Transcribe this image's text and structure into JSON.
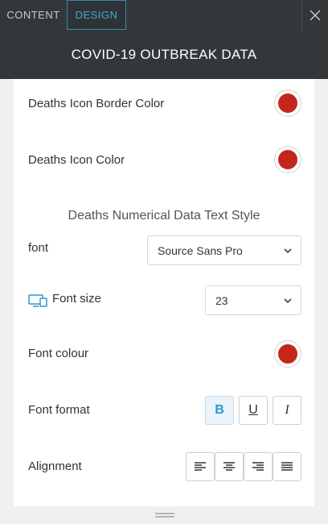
{
  "tabs": [
    {
      "label": "CONTENT",
      "active": false
    },
    {
      "label": "DESIGN",
      "active": true
    }
  ],
  "header": {
    "title": "COVID-19 OUTBREAK DATA"
  },
  "settings": {
    "icon_border_color": {
      "label": "Deaths Icon Border Color",
      "color": "#c4261d"
    },
    "icon_color": {
      "label": "Deaths Icon Color",
      "color": "#c4261d"
    },
    "section_title": "Deaths Numerical Data Text Style",
    "font": {
      "label": "font",
      "value": "Source Sans Pro"
    },
    "font_size": {
      "label": "Font size",
      "value": "23",
      "icon": "desktop-tablet-icon"
    },
    "font_colour": {
      "label": "Font colour",
      "color": "#c4261d"
    },
    "font_format": {
      "label": "Font format",
      "buttons": [
        {
          "glyph": "B",
          "name": "bold",
          "active": true
        },
        {
          "glyph": "U",
          "name": "underline",
          "active": false
        },
        {
          "glyph": "I",
          "name": "italic",
          "active": false
        }
      ]
    },
    "alignment": {
      "label": "Alignment",
      "options": [
        "left",
        "center",
        "right",
        "justify"
      ]
    }
  },
  "colors": {
    "dark_bar": "#333739",
    "accent": "#3fa7d9"
  }
}
